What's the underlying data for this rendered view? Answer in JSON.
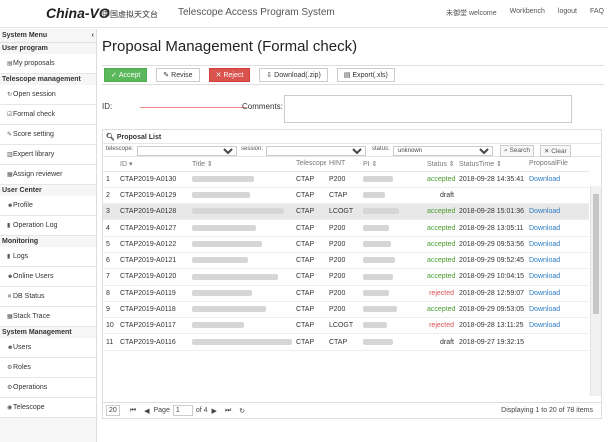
{
  "header": {
    "logo": "China-VO",
    "org": "中国虚拟天文台",
    "title": "Telescope Access Program System",
    "nav": [
      "未御堂 welcome",
      "Workbench",
      "logout",
      "FAQ"
    ]
  },
  "sidebar": {
    "menu_label": "System Menu",
    "collapse": "‹",
    "groups": [
      {
        "label": "User program",
        "items": [
          "My proposals"
        ]
      },
      {
        "label": "Telescope management",
        "items": [
          "Open session",
          "Formal check",
          "Score setting",
          "Expert library",
          "Assign reviewer"
        ]
      },
      {
        "label": "User Center",
        "items": [
          "Profile",
          "Operation Log"
        ]
      },
      {
        "label": "Monitoring",
        "items": [
          "Logs",
          "Online Users",
          "DB Status",
          "Stack Trace"
        ]
      },
      {
        "label": "System Management",
        "items": [
          "Users",
          "Roles",
          "Operations",
          "Telescope"
        ]
      }
    ]
  },
  "main": {
    "title": "Proposal Management (Formal check)",
    "toolbar": {
      "accept": "Accept",
      "revise": "Revise",
      "reject": "Reject",
      "download": "Download(.zip)",
      "export": "Export(.xls)"
    },
    "form": {
      "id_label": "ID:",
      "comments_label": "Comments:"
    },
    "list": {
      "title": "Proposal List",
      "filters": {
        "telescope_label": "telescope:",
        "session_label": "session:",
        "status_label": "status:",
        "status_value": "unknown",
        "search": "Search",
        "clear": "Clear"
      },
      "columns": [
        "",
        "ID",
        "Title",
        "Telescope",
        "HINT",
        "PI",
        "Status",
        "StatusTime",
        "ProposalFile"
      ],
      "rows": [
        {
          "n": "1",
          "id": "CTAP2019-A0130",
          "tel": "CTAP",
          "hint": "P200",
          "status": "accepted",
          "time": "2018-09-28 14:35:41",
          "file": "Download"
        },
        {
          "n": "2",
          "id": "CTAP2019-A0129",
          "tel": "CTAP",
          "hint": "CTAP",
          "status": "draft",
          "time": "",
          "file": ""
        },
        {
          "n": "3",
          "id": "CTAP2019-A0128",
          "tel": "CTAP",
          "hint": "LCOGT",
          "status": "accepted",
          "time": "2018-09-28 15:01:36",
          "file": "Download"
        },
        {
          "n": "4",
          "id": "CTAP2019-A0127",
          "tel": "CTAP",
          "hint": "P200",
          "status": "accepted",
          "time": "2018-09-28 13:05:11",
          "file": "Download"
        },
        {
          "n": "5",
          "id": "CTAP2019-A0122",
          "tel": "CTAP",
          "hint": "P200",
          "status": "accepted",
          "time": "2018-09-29 09:53:56",
          "file": "Download"
        },
        {
          "n": "6",
          "id": "CTAP2019-A0121",
          "tel": "CTAP",
          "hint": "P200",
          "status": "accepted",
          "time": "2018-09-29 09:52:45",
          "file": "Download"
        },
        {
          "n": "7",
          "id": "CTAP2019-A0120",
          "tel": "CTAP",
          "hint": "P200",
          "status": "accepted",
          "time": "2018-09-29 10:04:15",
          "file": "Download"
        },
        {
          "n": "8",
          "id": "CTAP2019-A0119",
          "tel": "CTAP",
          "hint": "P200",
          "status": "rejected",
          "time": "2018-09-28 12:59:07",
          "file": "Download"
        },
        {
          "n": "9",
          "id": "CTAP2019-A0118",
          "tel": "CTAP",
          "hint": "P200",
          "status": "accepted",
          "time": "2018-09-29 09:53:05",
          "file": "Download"
        },
        {
          "n": "10",
          "id": "CTAP2019-A0117",
          "tel": "CTAP",
          "hint": "LCOGT",
          "status": "rejected",
          "time": "2018-09-28 13:11:25",
          "file": "Download"
        },
        {
          "n": "11",
          "id": "CTAP2019-A0116",
          "tel": "CTAP",
          "hint": "CTAP",
          "status": "draft",
          "time": "2018-09-27 19:32:15",
          "file": ""
        }
      ]
    },
    "pager": {
      "size": "20",
      "page_label": "Page",
      "page": "1",
      "of": "of 4",
      "display": "Displaying 1 to 20 of 78 items"
    }
  }
}
